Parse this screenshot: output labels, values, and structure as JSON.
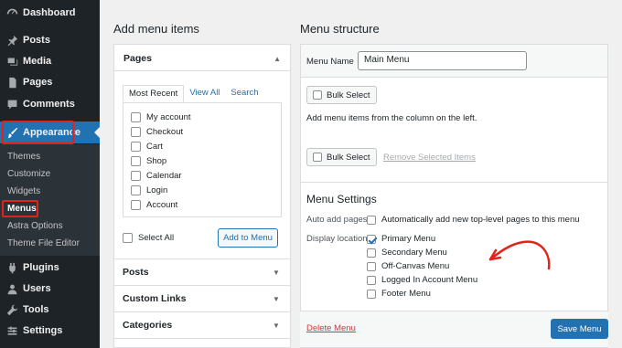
{
  "sidebar": {
    "items": [
      {
        "label": "Dashboard",
        "icon": "dashboard-icon"
      },
      {
        "label": "Posts",
        "icon": "pin-icon"
      },
      {
        "label": "Media",
        "icon": "media-icon"
      },
      {
        "label": "Pages",
        "icon": "page-icon"
      },
      {
        "label": "Comments",
        "icon": "comment-icon"
      },
      {
        "label": "Appearance",
        "icon": "paintbrush-icon"
      },
      {
        "label": "Plugins",
        "icon": "plugin-icon"
      },
      {
        "label": "Users",
        "icon": "user-icon"
      },
      {
        "label": "Tools",
        "icon": "wrench-icon"
      },
      {
        "label": "Settings",
        "icon": "settings-icon"
      }
    ],
    "submenu": [
      "Themes",
      "Customize",
      "Widgets",
      "Menus",
      "Astra Options",
      "Theme File Editor"
    ],
    "active_submenu": "Menus"
  },
  "add_items": {
    "title": "Add menu items",
    "pages_title": "Pages",
    "tabs": [
      "Most Recent",
      "View All",
      "Search"
    ],
    "pages": [
      "My account",
      "Checkout",
      "Cart",
      "Shop",
      "Calendar",
      "Login",
      "Account"
    ],
    "select_all": "Select All",
    "add_to_menu": "Add to Menu",
    "accordions": [
      "Posts",
      "Custom Links",
      "Categories"
    ]
  },
  "structure": {
    "title": "Menu structure",
    "menu_name_label": "Menu Name",
    "menu_name_value": "Main Menu",
    "bulk_select": "Bulk Select",
    "hint": "Add menu items from the column on the left.",
    "remove_selected": "Remove Selected Items",
    "settings_title": "Menu Settings",
    "auto_add_label": "Auto add pages",
    "auto_add_text": "Automatically add new top-level pages to this menu",
    "display_location_label": "Display location",
    "locations": [
      {
        "label": "Primary Menu",
        "checked": true
      },
      {
        "label": "Secondary Menu",
        "checked": false
      },
      {
        "label": "Off-Canvas Menu",
        "checked": false
      },
      {
        "label": "Logged In Account Menu",
        "checked": false
      },
      {
        "label": "Footer Menu",
        "checked": false
      }
    ],
    "delete_menu": "Delete Menu",
    "save_menu": "Save Menu"
  },
  "colors": {
    "sidebar_bg": "#1d2327",
    "accent": "#2271b1",
    "highlight": "#e0241b"
  }
}
